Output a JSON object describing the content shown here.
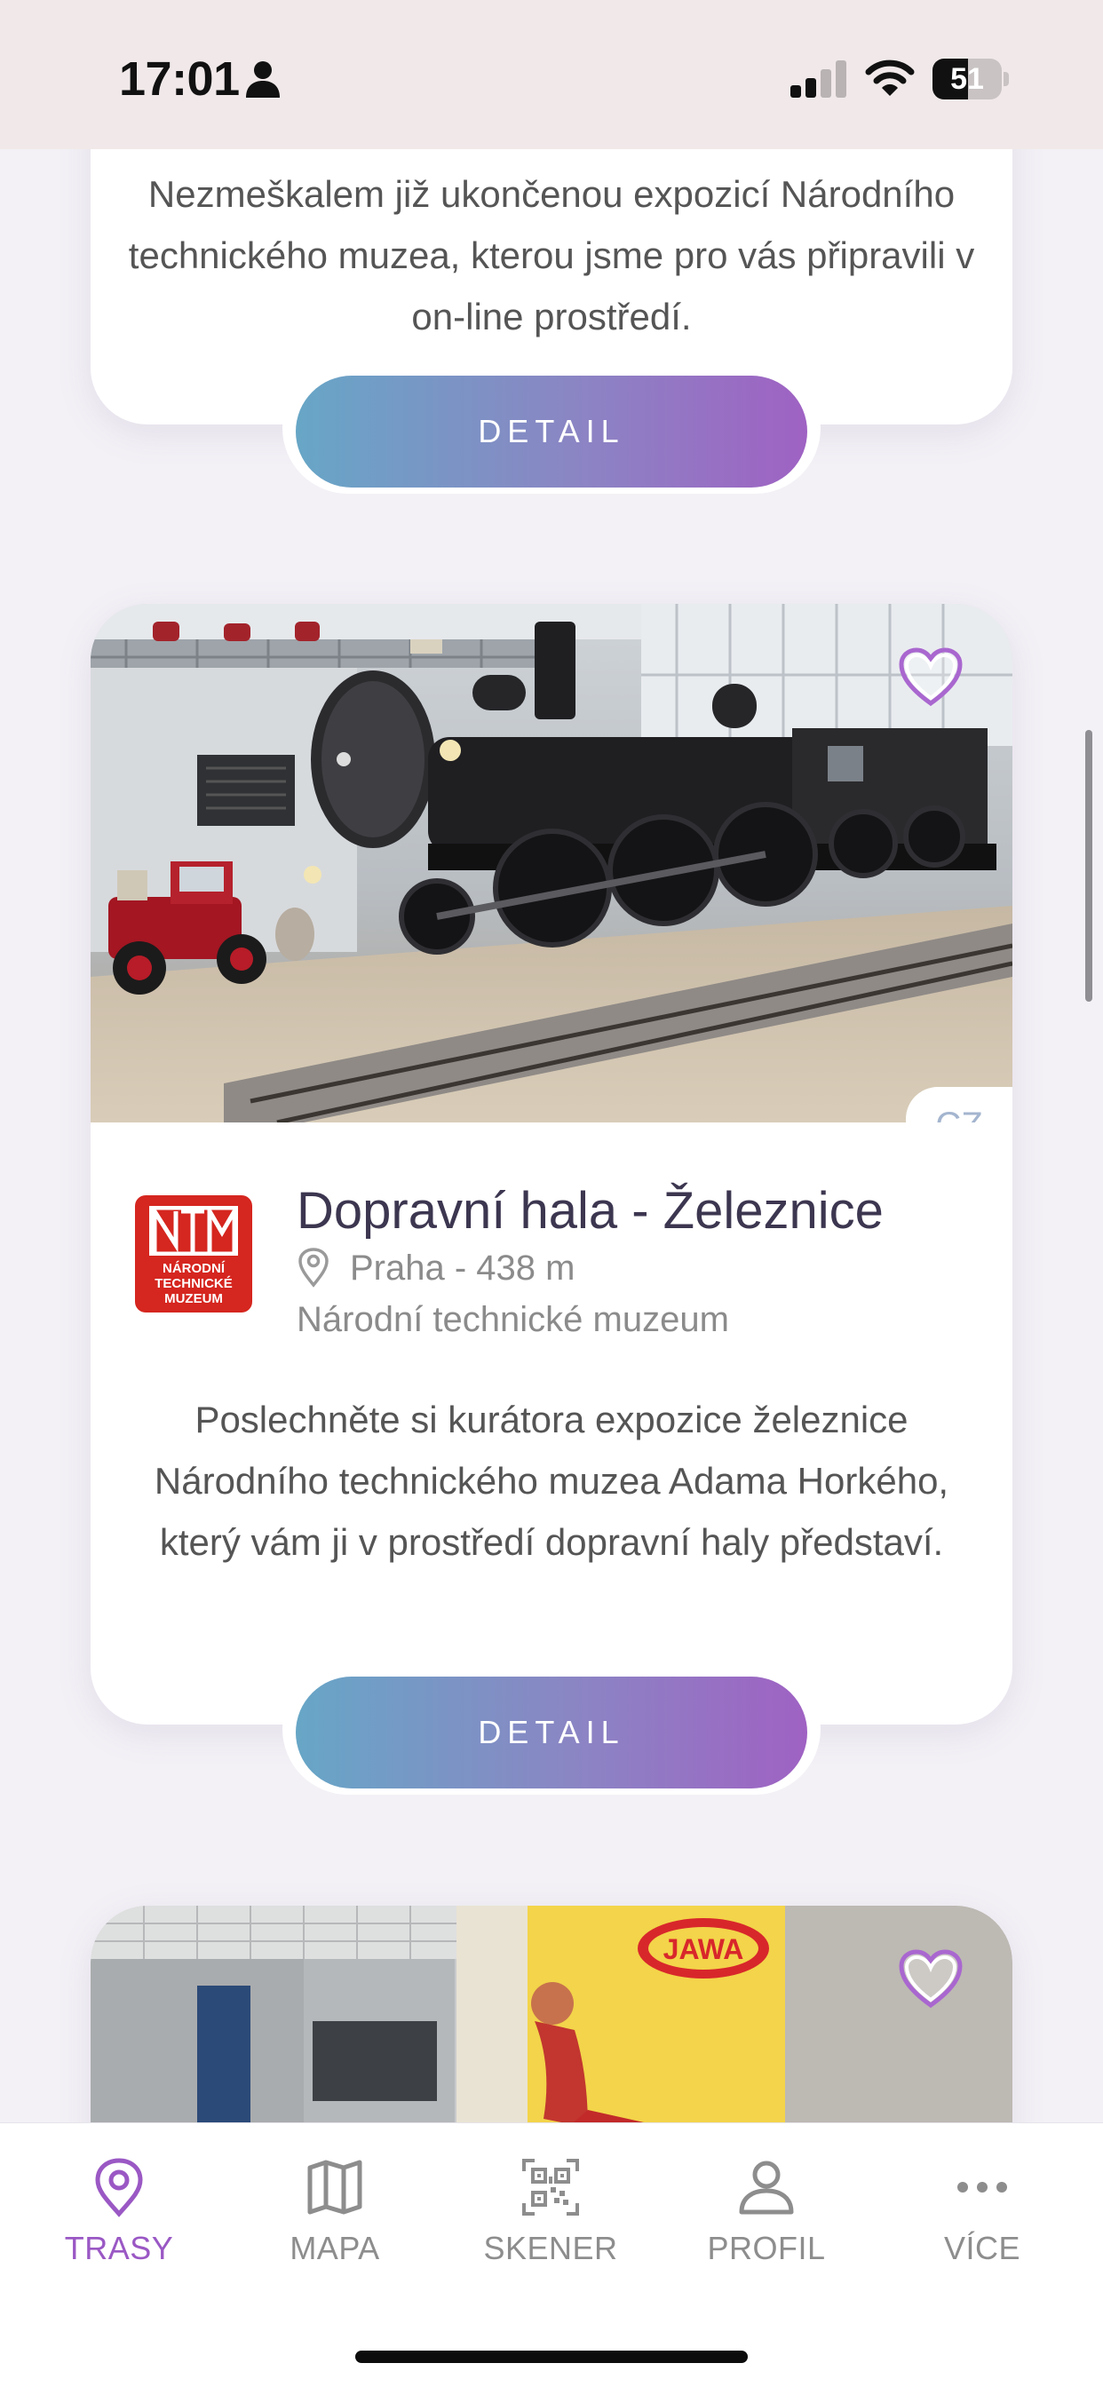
{
  "status_bar": {
    "time": "17:01",
    "battery_level": "51",
    "battery_fraction": 0.51
  },
  "cards": [
    {
      "description": "Nezmeškalem již ukončenou expozicí Národního technického muzea, kterou jsme pro vás připravili v on-line prostředí.",
      "button_label": "DETAIL"
    },
    {
      "title": "Dopravní hala - Železnice",
      "location": "Praha - 438 m",
      "museum": "Národní technické muzeum",
      "language": "CZ",
      "logo_text": "NÁRODNÍ TECHNICKÉ MUZEUM",
      "description": "Poslechněte si kurátora expozice železnice Národního technického muzea Adama Horkého, který vám ji v prostředí dopravní haly představí.",
      "button_label": "DETAIL"
    },
    {
      "poster_text": "JAWA"
    }
  ],
  "tabs": [
    {
      "label": "TRASY",
      "icon": "map-pin-icon",
      "active": true
    },
    {
      "label": "MAPA",
      "icon": "map-icon",
      "active": false
    },
    {
      "label": "SKENER",
      "icon": "qr-code-icon",
      "active": false
    },
    {
      "label": "PROFIL",
      "icon": "user-icon",
      "active": false
    },
    {
      "label": "VÍCE",
      "icon": "more-icon",
      "active": false
    }
  ],
  "colors": {
    "accent": "#9a58c4",
    "button_gradient_start": "#67a6c6",
    "button_gradient_end": "#9f62c3",
    "logo_red": "#d5261f"
  }
}
